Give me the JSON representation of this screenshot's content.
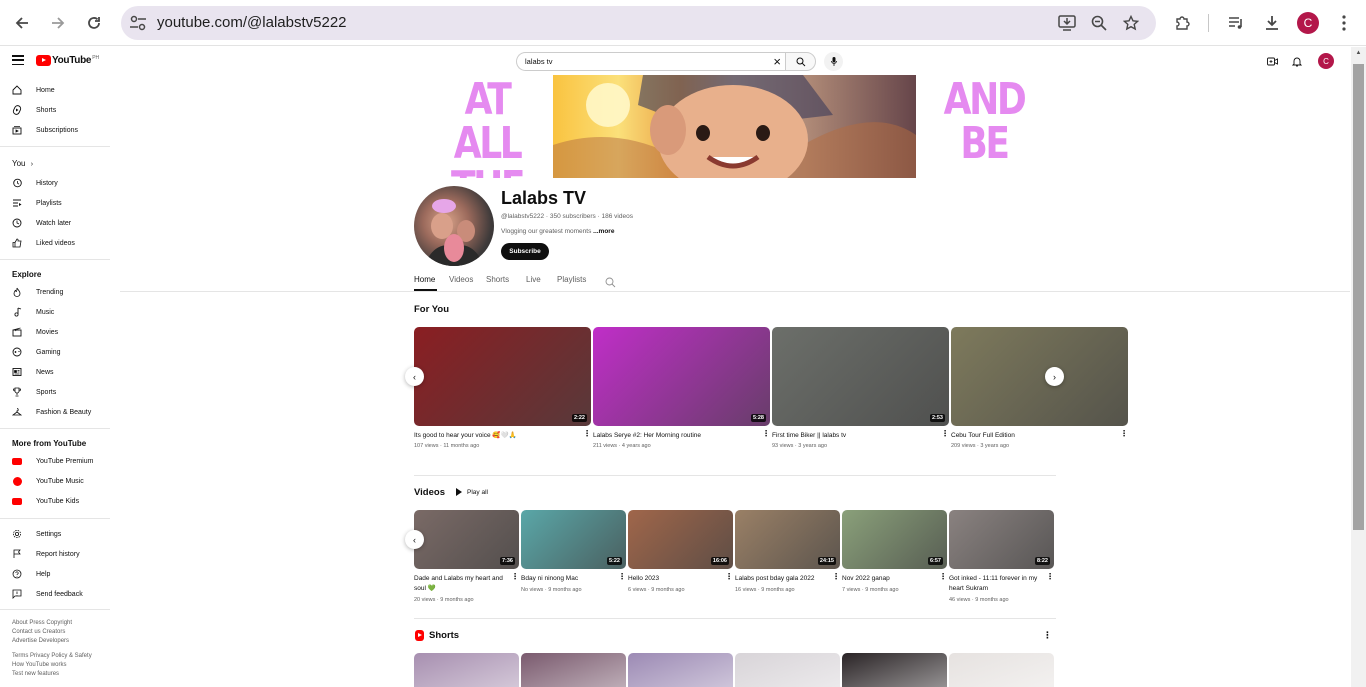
{
  "browser": {
    "url": "youtube.com/@lalabstv5222",
    "profile_initial": "C"
  },
  "topbar": {
    "logo_text": "YouTube",
    "logo_country": "PH",
    "search_query": "lalabs tv",
    "avatar_initial": "C"
  },
  "sidebar": {
    "main": [
      {
        "label": "Home",
        "icon": "home-icon"
      },
      {
        "label": "Shorts",
        "icon": "shorts-icon"
      },
      {
        "label": "Subscriptions",
        "icon": "subscriptions-icon"
      }
    ],
    "you_heading": "You",
    "you_items": [
      {
        "label": "History",
        "icon": "history-icon"
      },
      {
        "label": "Playlists",
        "icon": "playlists-icon"
      },
      {
        "label": "Watch later",
        "icon": "clock-icon"
      },
      {
        "label": "Liked videos",
        "icon": "thumbs-up-icon"
      }
    ],
    "explore_heading": "Explore",
    "explore_items": [
      {
        "label": "Trending",
        "icon": "flame-icon"
      },
      {
        "label": "Music",
        "icon": "music-note-icon"
      },
      {
        "label": "Movies",
        "icon": "clapperboard-icon"
      },
      {
        "label": "Gaming",
        "icon": "gamepad-icon"
      },
      {
        "label": "News",
        "icon": "newspaper-icon"
      },
      {
        "label": "Sports",
        "icon": "trophy-icon"
      },
      {
        "label": "Fashion & Beauty",
        "icon": "hanger-icon"
      }
    ],
    "more_heading": "More from YouTube",
    "more_items": [
      {
        "label": "YouTube Premium"
      },
      {
        "label": "YouTube Music"
      },
      {
        "label": "YouTube Kids"
      }
    ],
    "settings_items": [
      {
        "label": "Settings",
        "icon": "gear-icon"
      },
      {
        "label": "Report history",
        "icon": "flag-icon"
      },
      {
        "label": "Help",
        "icon": "help-icon"
      },
      {
        "label": "Send feedback",
        "icon": "feedback-icon"
      }
    ],
    "footer_line1": "About  Press  Copyright",
    "footer_line2": "Contact us  Creators",
    "footer_line3": "Advertise  Developers",
    "footer_line4": "Terms  Privacy  Policy & Safety",
    "footer_line5": "How YouTube works",
    "footer_line6": "Test new features"
  },
  "banner": {
    "left_text_1": "AT ALL",
    "left_text_2": "THE",
    "right_text_1": "AND",
    "right_text_2": "BE"
  },
  "channel": {
    "name": "Lalabs TV",
    "meta": "@lalabstv5222 · 350 subscribers · 186 videos",
    "description": "Vlogging our greatest moments",
    "more": "...more",
    "subscribe_label": "Subscribe"
  },
  "tabs": [
    "Home",
    "Videos",
    "Shorts",
    "Live",
    "Playlists"
  ],
  "for_you": {
    "title": "For You",
    "videos": [
      {
        "title": "Its good to hear your voice 🥰🤍🙏",
        "meta": "107 views · 11 months ago",
        "duration": "2:22",
        "color": "#8a1e22"
      },
      {
        "title": "Lalabs Serye #2: Her Morning routine",
        "meta": "211 views · 4 years ago",
        "duration": "5:28",
        "color": "#c02ec8"
      },
      {
        "title": "First time Biker || lalabs tv",
        "meta": "93 views · 3 years ago",
        "duration": "2:53",
        "color": "#6c6f6a"
      },
      {
        "title": "Cebu Tour Full Edition",
        "meta": "209 views · 3 years ago",
        "duration": "",
        "color": "#7e7a5c"
      }
    ]
  },
  "videos_section": {
    "title": "Videos",
    "play_all": "Play all",
    "videos": [
      {
        "title": "Dade and Lalabs my heart and soul 💚",
        "meta": "20 views · 9 months ago",
        "duration": "7:36",
        "color": "#7a6a66"
      },
      {
        "title": "Bday ni ninong Mac",
        "meta": "No views · 9 months ago",
        "duration": "5:22",
        "color": "#5aa7a8"
      },
      {
        "title": "Hello 2023",
        "meta": "6 views · 9 months ago",
        "duration": "16:06",
        "color": "#a0664a"
      },
      {
        "title": "Lalabs post bday gala 2022",
        "meta": "16 views · 9 months ago",
        "duration": "24:15",
        "color": "#9a8066"
      },
      {
        "title": "Nov 2022 ganap",
        "meta": "7 views · 9 months ago",
        "duration": "6:57",
        "color": "#8aa07a"
      },
      {
        "title": "Got inked - 11:11 forever in my heart Sukram",
        "meta": "46 views · 9 months ago",
        "duration": "8:22",
        "color": "#8a8280"
      }
    ]
  },
  "shorts_section": {
    "title": "Shorts",
    "colors": [
      "#a78fb0",
      "#7a5a6e",
      "#9c8ab4",
      "#d8d4d8",
      "#2a2426",
      "#e6e2e0"
    ]
  }
}
